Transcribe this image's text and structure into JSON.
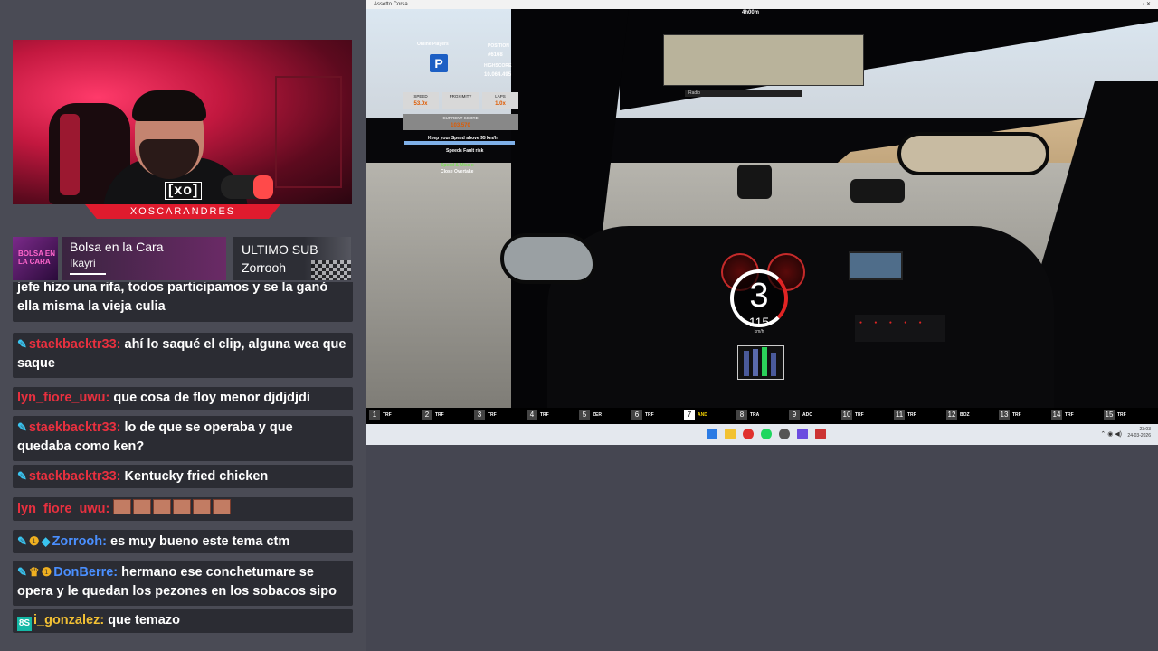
{
  "streamer": {
    "logo_text": "[xo]",
    "name": "XOSCARANDRES"
  },
  "music": {
    "album_art_text": "BOLSA EN LA CARA",
    "title": "Bolsa en la Cara",
    "artist": "Ikayri",
    "progress": 0.22
  },
  "last_sub": {
    "title": "ULTIMO SUB",
    "name": "Zorrooh"
  },
  "chat": [
    {
      "badges": [],
      "user": "",
      "text": "jefe hizo una rifa, todos participamos y se la ganó ella misma la vieja culia",
      "color": ""
    },
    {
      "badges": [
        "pencil"
      ],
      "user": "staekbacktr33:",
      "text": "ahí lo saqué el clip, alguna wea que saque",
      "color": "red"
    },
    {
      "badges": [],
      "user": "lyn_fiore_uwu:",
      "text": "que cosa de floy menor djdjdjdi",
      "color": "red"
    },
    {
      "badges": [
        "pencil"
      ],
      "user": "staekbacktr33:",
      "text": "lo de que se operaba y que quedaba como ken?",
      "color": "red"
    },
    {
      "badges": [
        "pencil"
      ],
      "user": "staekbacktr33:",
      "text": "Kentucky fried chicken",
      "color": "red"
    },
    {
      "badges": [],
      "user": "lyn_fiore_uwu:",
      "text": "",
      "color": "red",
      "emotes": 6
    },
    {
      "badges": [
        "pencil",
        "one",
        "cube"
      ],
      "user": "Zorrooh:",
      "text": "es muy bueno este tema ctm",
      "color": "blue"
    },
    {
      "badges": [
        "pencil",
        "crown",
        "one"
      ],
      "user": "DonBerre:",
      "text": "hermano ese conchetumare se opera y le quedan los pezones en los sobacos sipo",
      "color": "blue"
    },
    {
      "badges": [
        "tag"
      ],
      "user": "i_gonzalez:",
      "text": "que temazo",
      "color": "gold"
    }
  ],
  "game": {
    "window_title": "Assetto Corsa",
    "session_time": "4h00m",
    "mirror_label": "Radio",
    "hud": {
      "server": "Online Players",
      "position_label": "POSITION",
      "position_value": "#6168",
      "highscore_label": "HIGHSCORE",
      "highscore_value": "10.064.495",
      "speed_label": "SPEED",
      "speed_value": "53.0x",
      "proximity_label": "PROXIMITY",
      "proximity_value": "",
      "laps_label": "LAPS",
      "laps_value": "1.0x",
      "score_label": "CURRENT SCORE",
      "score_value": "103.570",
      "hint": "Keep your Speed above 95 km/h",
      "hint2": "Speeds Fault risk",
      "near_miss": "Speed & Miss x",
      "close_overtake": "Close Overtake"
    },
    "gear": "3",
    "speed": "115",
    "speed_unit": "km/h",
    "positions": [
      {
        "n": "1",
        "code": "TRF"
      },
      {
        "n": "2",
        "code": "TRF"
      },
      {
        "n": "3",
        "code": "TRF"
      },
      {
        "n": "4",
        "code": "TRF"
      },
      {
        "n": "5",
        "code": "ZER"
      },
      {
        "n": "6",
        "code": "TRF"
      },
      {
        "n": "7",
        "code": "AND",
        "active": true
      },
      {
        "n": "8",
        "code": "TRA"
      },
      {
        "n": "9",
        "code": "ADO"
      },
      {
        "n": "10",
        "code": "TRF"
      },
      {
        "n": "11",
        "code": "TRF"
      },
      {
        "n": "12",
        "code": "BOZ"
      },
      {
        "n": "13",
        "code": "TRF"
      },
      {
        "n": "14",
        "code": "TRF"
      },
      {
        "n": "15",
        "code": "TRF"
      }
    ],
    "clock_time": "23:03",
    "clock_date": "24-03-2026"
  },
  "colors": {
    "accent_red": "#e01b2e",
    "chat_bg": "#2b2c33",
    "page_bg": "#454651"
  }
}
